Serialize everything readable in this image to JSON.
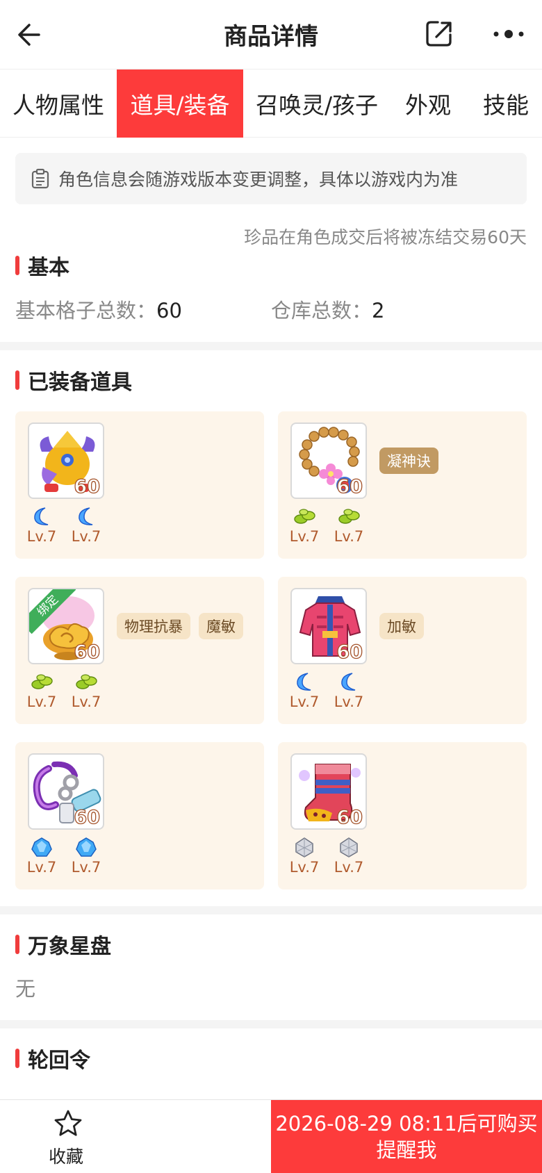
{
  "header": {
    "title": "商品详情",
    "back_icon": "arrow-left-icon",
    "share_icon": "share-icon",
    "more_icon": "more-dots-icon"
  },
  "tabs": [
    {
      "label": "人物属性",
      "active": false
    },
    {
      "label": "道具/装备",
      "active": true
    },
    {
      "label": "召唤灵/孩子",
      "active": false
    },
    {
      "label": "外观",
      "active": false
    },
    {
      "label": "技能",
      "active": false
    }
  ],
  "notice": {
    "icon": "clipboard-icon",
    "text": "角色信息会随游戏版本变更调整，具体以游戏内为准"
  },
  "freeze_notice": "珍品在角色成交后将被冻结交易60天",
  "basic": {
    "title": "基本",
    "slots_label": "基本格子总数：",
    "slots_value": "60",
    "warehouse_label": "仓库总数：",
    "warehouse_value": "2"
  },
  "equipped": {
    "title": "已装备道具",
    "items": [
      {
        "icon": "helmet-icon",
        "level": "60",
        "bound": false,
        "tags": [],
        "gems": [
          {
            "type": "moon-gem-icon",
            "level": "Lv.7"
          },
          {
            "type": "moon-gem-icon",
            "level": "Lv.7"
          }
        ]
      },
      {
        "icon": "necklace-icon",
        "level": "60",
        "bound": false,
        "tags": [
          {
            "text": "凝神诀",
            "style": "gold"
          }
        ],
        "gems": [
          {
            "type": "green-beans-gem-icon",
            "level": "Lv.7"
          },
          {
            "type": "green-beans-gem-icon",
            "level": "Lv.7"
          }
        ]
      },
      {
        "icon": "cloud-weapon-icon",
        "level": "60",
        "bound": true,
        "bound_label": "绑定",
        "tags": [
          {
            "text": "物理抗暴",
            "style": "beige"
          },
          {
            "text": "魔敏",
            "style": "beige"
          }
        ],
        "gems": [
          {
            "type": "green-beans-gem-icon",
            "level": "Lv.7"
          },
          {
            "type": "green-beans-gem-icon",
            "level": "Lv.7"
          }
        ]
      },
      {
        "icon": "armor-icon",
        "level": "60",
        "bound": false,
        "tags": [
          {
            "text": "加敏",
            "style": "beige"
          }
        ],
        "gems": [
          {
            "type": "moon-gem-icon",
            "level": "Lv.7"
          },
          {
            "type": "moon-gem-icon",
            "level": "Lv.7"
          }
        ]
      },
      {
        "icon": "belt-icon",
        "level": "60",
        "bound": false,
        "tags": [],
        "gems": [
          {
            "type": "blue-crystal-gem-icon",
            "level": "Lv.7"
          },
          {
            "type": "blue-crystal-gem-icon",
            "level": "Lv.7"
          }
        ]
      },
      {
        "icon": "boots-icon",
        "level": "60",
        "bound": false,
        "tags": [],
        "gems": [
          {
            "type": "white-diamond-gem-icon",
            "level": "Lv.7"
          },
          {
            "type": "white-diamond-gem-icon",
            "level": "Lv.7"
          }
        ]
      }
    ]
  },
  "star_disk": {
    "title": "万象星盘",
    "value": "无"
  },
  "rebirth": {
    "title": "轮回令"
  },
  "bottom": {
    "favorite_label": "收藏",
    "favorite_icon": "star-outline-icon",
    "remind_line1": "2026-08-29 08:11后可购买",
    "remind_line2": "提醒我"
  },
  "colors": {
    "accent": "#fd3b3b",
    "card_bg": "#fdf5ea",
    "gem_level": "#b05a2d"
  }
}
